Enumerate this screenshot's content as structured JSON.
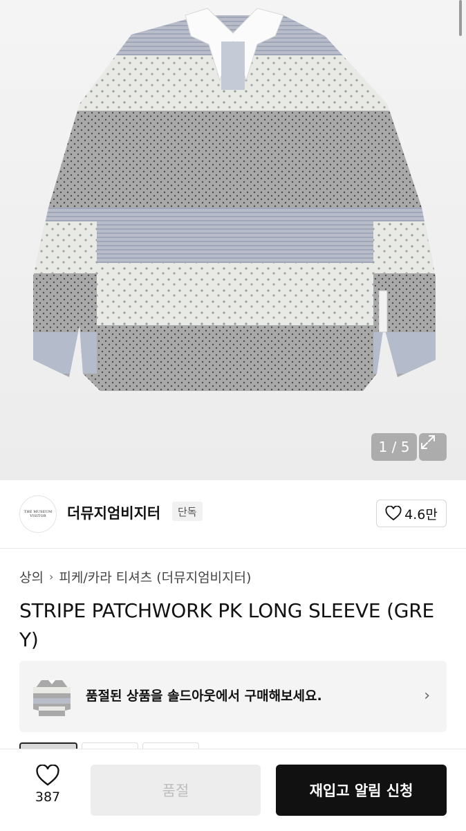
{
  "gallery": {
    "counter": "1 / 5",
    "icons": {
      "expand": "expand-arrows-icon"
    }
  },
  "brand": {
    "logo_text": "THE MUSEUM VISITOR",
    "name": "더뮤지엄비지터",
    "badge": "단독",
    "likes": "4.6만",
    "icons": {
      "like": "heart-outline-icon"
    }
  },
  "breadcrumb": {
    "category": "상의",
    "subcategory": "피케/카라 티셔츠 (더뮤지엄비지터)",
    "icons": {
      "separator": "chevron-right-icon"
    }
  },
  "product": {
    "title": "STRIPE PATCHWORK PK LONG SLEEVE (GREY)"
  },
  "soldout_banner": {
    "text": "품절된 상품을 솔드아웃에서 구매해보세요.",
    "icons": {
      "arrow": "chevron-right-icon"
    }
  },
  "bottom_bar": {
    "wish_count": "387",
    "soldout_label": "품절",
    "restock_label": "재입고 알림 신청",
    "icons": {
      "wish": "heart-outline-icon"
    }
  },
  "colors": {
    "primary_button": "#111111",
    "disabled_button": "#ededed",
    "disabled_text": "#bdbdbd"
  }
}
